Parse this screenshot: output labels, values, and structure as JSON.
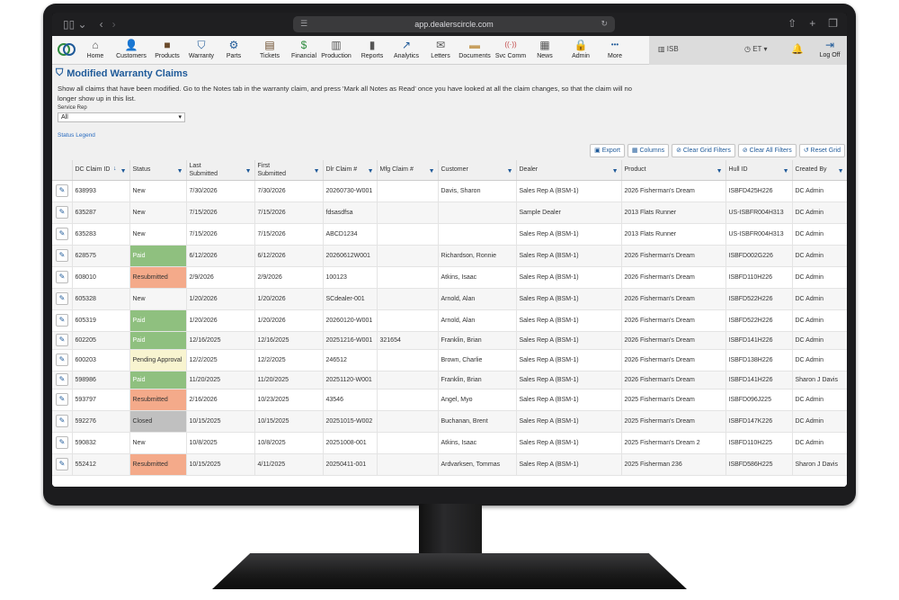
{
  "browser": {
    "url": "app.dealerscircle.com"
  },
  "nav": {
    "items": [
      {
        "label": "Home",
        "icon": "home-icon",
        "glyph": "⌂",
        "color": "#555555"
      },
      {
        "label": "Customers",
        "icon": "customers-icon",
        "glyph": "👤",
        "color": "#2a6cc0"
      },
      {
        "label": "Products",
        "icon": "products-icon",
        "glyph": "■",
        "color": "#6a4a2a"
      },
      {
        "label": "Warranty",
        "icon": "warranty-shield-icon",
        "glyph": "⛉",
        "color": "#1f5a99"
      },
      {
        "label": "Parts",
        "icon": "parts-gear-icon",
        "glyph": "⚙",
        "color": "#1f5a99"
      },
      {
        "label": "Tickets",
        "icon": "tickets-clipboard-icon",
        "glyph": "▤",
        "color": "#6a4a2a"
      },
      {
        "label": "Financial",
        "icon": "financial-dollar-icon",
        "glyph": "$",
        "color": "#2e8b3e"
      },
      {
        "label": "Production",
        "icon": "production-factory-icon",
        "glyph": "▥",
        "color": "#555555"
      },
      {
        "label": "Reports",
        "icon": "reports-chart-icon",
        "glyph": "▮",
        "color": "#555555"
      },
      {
        "label": "Analytics",
        "icon": "analytics-line-icon",
        "glyph": "↗",
        "color": "#1f5a99"
      },
      {
        "label": "Letters",
        "icon": "letters-envelope-icon",
        "glyph": "✉",
        "color": "#555555"
      },
      {
        "label": "Documents",
        "icon": "documents-folder-icon",
        "glyph": "▬",
        "color": "#c8a060"
      },
      {
        "label": "Svc Comm",
        "icon": "svc-comm-antenna-icon",
        "glyph": "((·))",
        "color": "#c04040"
      },
      {
        "label": "News",
        "icon": "news-icon",
        "glyph": "▦",
        "color": "#555555"
      },
      {
        "label": "Admin",
        "icon": "admin-lock-icon",
        "glyph": "🔒",
        "color": "#555555"
      },
      {
        "label": "More",
        "icon": "more-dots-icon",
        "glyph": "•••",
        "color": "#1f5a99"
      }
    ],
    "location": "ISB",
    "timezone": "ET",
    "logoff": "Log Off"
  },
  "page": {
    "title": "Modified Warranty Claims",
    "description": "Show all claims that have been modified. Go to the Notes tab in the warranty claim, and press 'Mark all Notes as Read' once you have looked at all the claim changes, so that the claim will no longer show up in this list.",
    "service_rep_label": "Service Rep",
    "service_rep_value": "All",
    "status_legend": "Status Legend"
  },
  "toolbar": {
    "export": "Export",
    "columns": "Columns",
    "clear_grid_filters": "Clear Grid Filters",
    "clear_all_filters": "Clear All Filters",
    "reset_grid": "Reset Grid"
  },
  "grid": {
    "columns": [
      "DC Claim ID",
      "Status",
      "Last Submitted",
      "First Submitted",
      "Dlr Claim #",
      "Mfg Claim #",
      "Customer",
      "Dealer",
      "Product",
      "Hull ID",
      "Created By"
    ],
    "rows": [
      {
        "id": "638993",
        "status": "New",
        "last": "7/30/2026",
        "first": "7/30/2026",
        "dlr": "20260730-W001",
        "mfg": "",
        "customer": "Davis, Sharon",
        "dealer": "Sales Rep A (BSM-1)",
        "product": "2026 Fisherman's Dream",
        "hull": "ISBFD425H226",
        "created": "DC Admin"
      },
      {
        "id": "635287",
        "status": "New",
        "last": "7/15/2026",
        "first": "7/15/2026",
        "dlr": "fdsasdfsa",
        "mfg": "",
        "customer": "",
        "dealer": "Sample Dealer",
        "product": "2013 Flats Runner",
        "hull": "US-ISBFR004H313",
        "created": "DC Admin"
      },
      {
        "id": "635283",
        "status": "New",
        "last": "7/15/2026",
        "first": "7/15/2026",
        "dlr": "ABCD1234",
        "mfg": "",
        "customer": "",
        "dealer": "Sales Rep A (BSM-1)",
        "product": "2013 Flats Runner",
        "hull": "US-ISBFR004H313",
        "created": "DC Admin"
      },
      {
        "id": "628575",
        "status": "Paid",
        "last": "6/12/2026",
        "first": "6/12/2026",
        "dlr": "20260612W001",
        "mfg": "",
        "customer": "Richardson, Ronnie",
        "dealer": "Sales Rep A (BSM-1)",
        "product": "2026 Fisherman's Dream",
        "hull": "ISBFD002G226",
        "created": "DC Admin"
      },
      {
        "id": "608010",
        "status": "Resubmitted",
        "last": "2/9/2026",
        "first": "2/9/2026",
        "dlr": "100123",
        "mfg": "",
        "customer": "Atkins, Isaac",
        "dealer": "Sales Rep A (BSM-1)",
        "product": "2026 Fisherman's Dream",
        "hull": "ISBFD110H226",
        "created": "DC Admin"
      },
      {
        "id": "605328",
        "status": "New",
        "last": "1/20/2026",
        "first": "1/20/2026",
        "dlr": "SCdealer-001",
        "mfg": "",
        "customer": "Arnold, Alan",
        "dealer": "Sales Rep A (BSM-1)",
        "product": "2026 Fisherman's Dream",
        "hull": "ISBFD522H226",
        "created": "DC Admin"
      },
      {
        "id": "605319",
        "status": "Paid",
        "last": "1/20/2026",
        "first": "1/20/2026",
        "dlr": "20260120-W001",
        "mfg": "",
        "customer": "Arnold, Alan",
        "dealer": "Sales Rep A (BSM-1)",
        "product": "2026 Fisherman's Dream",
        "hull": "ISBFD522H226",
        "created": "DC Admin"
      },
      {
        "id": "602205",
        "status": "Paid",
        "last": "12/16/2025",
        "first": "12/16/2025",
        "dlr": "20251216-W001",
        "mfg": "321654",
        "customer": "Franklin, Brian",
        "dealer": "Sales Rep A (BSM-1)",
        "product": "2026 Fisherman's Dream",
        "hull": "ISBFD141H226",
        "created": "DC Admin"
      },
      {
        "id": "600203",
        "status": "Pending Approval",
        "last": "12/2/2025",
        "first": "12/2/2025",
        "dlr": "246512",
        "mfg": "",
        "customer": "Brown, Charlie",
        "dealer": "Sales Rep A (BSM-1)",
        "product": "2026 Fisherman's Dream",
        "hull": "ISBFD138H226",
        "created": "DC Admin"
      },
      {
        "id": "598986",
        "status": "Paid",
        "last": "11/20/2025",
        "first": "11/20/2025",
        "dlr": "20251120-W001",
        "mfg": "",
        "customer": "Franklin, Brian",
        "dealer": "Sales Rep A (BSM-1)",
        "product": "2026 Fisherman's Dream",
        "hull": "ISBFD141H226",
        "created": "Sharon J Davis"
      },
      {
        "id": "593797",
        "status": "Resubmitted",
        "last": "2/16/2026",
        "first": "10/23/2025",
        "dlr": "43546",
        "mfg": "",
        "customer": "Angel, Myo",
        "dealer": "Sales Rep A (BSM-1)",
        "product": "2025 Fisherman's Dream",
        "hull": "ISBFD096J225",
        "created": "DC Admin"
      },
      {
        "id": "592276",
        "status": "Closed",
        "last": "10/15/2025",
        "first": "10/15/2025",
        "dlr": "20251015-W002",
        "mfg": "",
        "customer": "Buchanan, Brent",
        "dealer": "Sales Rep A (BSM-1)",
        "product": "2025 Fisherman's Dream",
        "hull": "ISBFD147K226",
        "created": "DC Admin"
      },
      {
        "id": "590832",
        "status": "New",
        "last": "10/8/2025",
        "first": "10/8/2025",
        "dlr": "20251008-001",
        "mfg": "",
        "customer": "Atkins, Isaac",
        "dealer": "Sales Rep A (BSM-1)",
        "product": "2025 Fisherman's Dream 2",
        "hull": "ISBFD110H225",
        "created": "DC Admin"
      },
      {
        "id": "552412",
        "status": "Resubmitted",
        "last": "10/15/2025",
        "first": "4/11/2025",
        "dlr": "20250411-001",
        "mfg": "",
        "customer": "Ardvarksen, Tommas",
        "dealer": "Sales Rep A (BSM-1)",
        "product": "2025 Fisherman 236",
        "hull": "ISBFD586H225",
        "created": "Sharon J Davis"
      }
    ]
  },
  "colors": {
    "paid": "#8fc07f",
    "resubmitted": "#f4aa8a",
    "closed": "#c0c0c0",
    "pending": "#f8f4d0",
    "accent": "#1f5a99"
  }
}
